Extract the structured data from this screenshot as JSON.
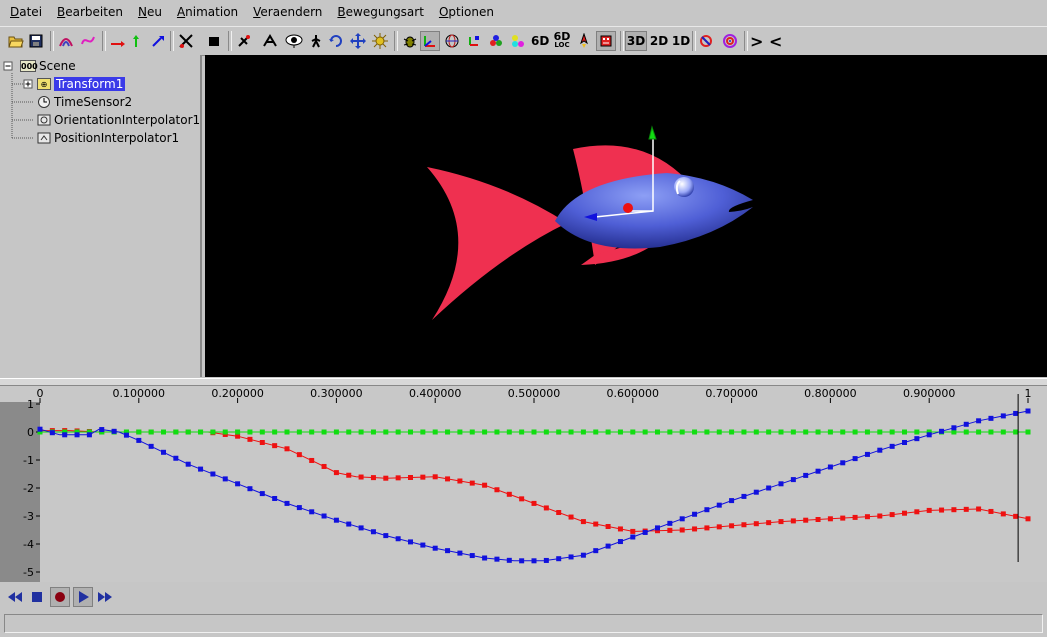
{
  "menu": {
    "items": [
      {
        "label": "Datei",
        "underline_index": 0
      },
      {
        "label": "Bearbeiten",
        "underline_index": 0
      },
      {
        "label": "Neu",
        "underline_index": 0
      },
      {
        "label": "Animation",
        "underline_index": 0
      },
      {
        "label": "Veraendern",
        "underline_index": 0
      },
      {
        "label": "Bewegungsart",
        "underline_index": 0
      },
      {
        "label": "Optionen",
        "underline_index": 0
      }
    ]
  },
  "toolbar": {
    "mode_3d": "3D",
    "mode_2d": "2D",
    "mode_1d": "1D",
    "label_6d": "6D",
    "label_6d_loc_top": "6D",
    "label_6d_loc_bottom": "LOC",
    "next": ">",
    "prev": "<"
  },
  "scene_tree": {
    "root": "Scene",
    "items": [
      {
        "label": "Transform1",
        "selected": true
      },
      {
        "label": "TimeSensor2"
      },
      {
        "label": "OrientationInterpolator1"
      },
      {
        "label": "PositionInterpolator1"
      }
    ]
  },
  "colors": {
    "fin": "#ef3050",
    "body": "#4f5fd6",
    "x_axis": "#ee1111",
    "y_axis": "#11dd11",
    "z_axis": "#1111dd",
    "selection": "#3a3ae8"
  },
  "chart_data": {
    "type": "line",
    "x_ticks": [
      "0",
      "0.100000",
      "0.200000",
      "0.300000",
      "0.400000",
      "0.500000",
      "0.600000",
      "0.700000",
      "0.800000",
      "0.900000",
      "1"
    ],
    "y_ticks": [
      "1",
      "0",
      "-1",
      "-2",
      "-3",
      "-4",
      "-5"
    ],
    "xlim": [
      0,
      1
    ],
    "ylim": [
      -5,
      1
    ],
    "cursor_x": 0.99,
    "series": [
      {
        "color": "#ee1111",
        "points": [
          [
            0,
            0.05
          ],
          [
            0.03,
            0.05
          ],
          [
            0.06,
            0
          ],
          [
            0.1,
            0
          ],
          [
            0.17,
            0
          ],
          [
            0.2,
            -0.15
          ],
          [
            0.25,
            -0.6
          ],
          [
            0.28,
            -1.1
          ],
          [
            0.3,
            -1.45
          ],
          [
            0.32,
            -1.6
          ],
          [
            0.35,
            -1.65
          ],
          [
            0.4,
            -1.6
          ],
          [
            0.45,
            -1.9
          ],
          [
            0.5,
            -2.55
          ],
          [
            0.55,
            -3.2
          ],
          [
            0.6,
            -3.55
          ],
          [
            0.65,
            -3.5
          ],
          [
            0.7,
            -3.35
          ],
          [
            0.75,
            -3.2
          ],
          [
            0.8,
            -3.1
          ],
          [
            0.85,
            -3.0
          ],
          [
            0.9,
            -2.8
          ],
          [
            0.95,
            -2.75
          ],
          [
            1.0,
            -3.1
          ]
        ]
      },
      {
        "color": "#11dd11",
        "points": [
          [
            0,
            0
          ],
          [
            0.1,
            0
          ],
          [
            0.2,
            0
          ],
          [
            0.3,
            0
          ],
          [
            0.4,
            0
          ],
          [
            0.5,
            0
          ],
          [
            0.6,
            0
          ],
          [
            0.7,
            0
          ],
          [
            0.8,
            0
          ],
          [
            0.9,
            0
          ],
          [
            1.0,
            0
          ]
        ]
      },
      {
        "color": "#1111dd",
        "points": [
          [
            0,
            0.1
          ],
          [
            0.02,
            -0.1
          ],
          [
            0.05,
            -0.1
          ],
          [
            0.06,
            0.1
          ],
          [
            0.08,
            0
          ],
          [
            0.1,
            -0.3
          ],
          [
            0.15,
            -1.15
          ],
          [
            0.2,
            -1.85
          ],
          [
            0.25,
            -2.55
          ],
          [
            0.3,
            -3.15
          ],
          [
            0.35,
            -3.7
          ],
          [
            0.4,
            -4.15
          ],
          [
            0.45,
            -4.5
          ],
          [
            0.48,
            -4.6
          ],
          [
            0.51,
            -4.6
          ],
          [
            0.55,
            -4.4
          ],
          [
            0.6,
            -3.75
          ],
          [
            0.65,
            -3.1
          ],
          [
            0.7,
            -2.45
          ],
          [
            0.75,
            -1.85
          ],
          [
            0.8,
            -1.25
          ],
          [
            0.85,
            -0.65
          ],
          [
            0.9,
            -0.1
          ],
          [
            0.95,
            0.4
          ],
          [
            1.0,
            0.75
          ]
        ]
      }
    ]
  }
}
